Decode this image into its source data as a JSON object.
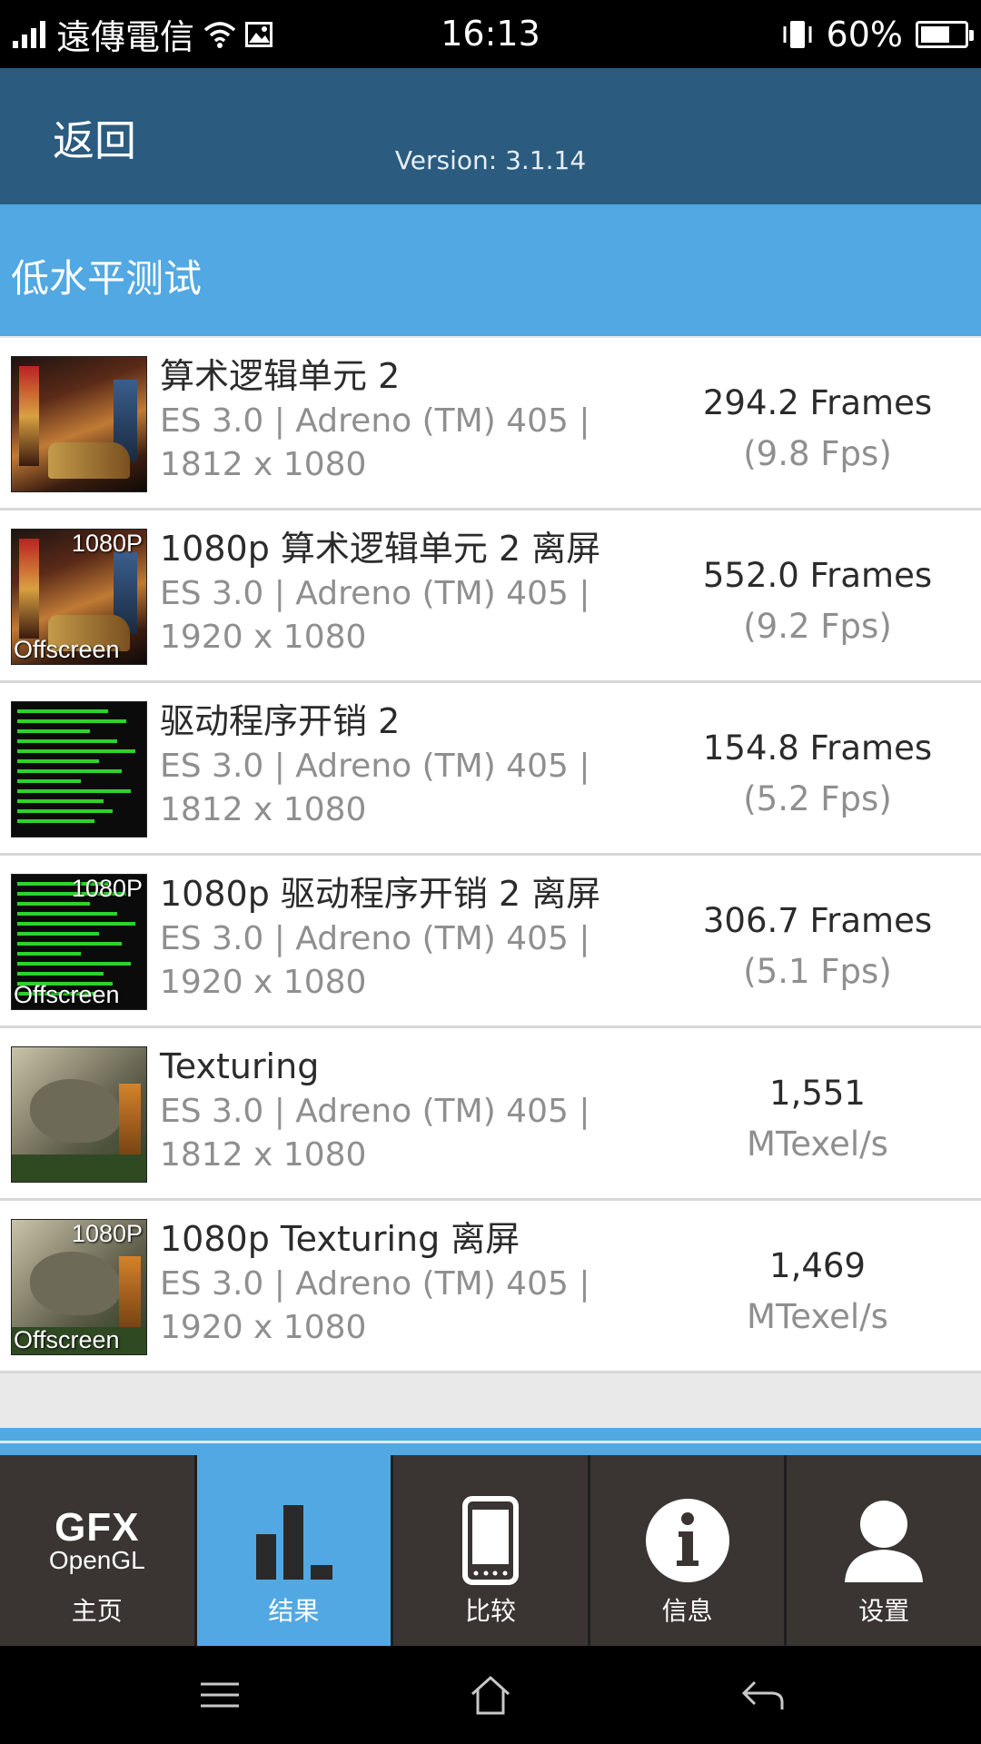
{
  "status_bar": {
    "carrier": "遠傳電信",
    "time": "16:13",
    "battery": "60%",
    "battery_level": 0.6
  },
  "header": {
    "back_label": "返回",
    "version": "Version: 3.1.14"
  },
  "section": {
    "title": "低水平测试"
  },
  "results": [
    {
      "name": "算术逻辑单元 2",
      "detail_line1": "ES 3.0 | Adreno (TM) 405 |",
      "detail_line2": "1812 x 1080",
      "primary": "294.2 Frames",
      "secondary": "(9.8 Fps)",
      "thumb": "scene",
      "tag_top": "",
      "tag_bottom": ""
    },
    {
      "name": "1080p 算术逻辑单元 2 离屏",
      "detail_line1": "ES 3.0 | Adreno (TM) 405 |",
      "detail_line2": "1920 x 1080",
      "primary": "552.0 Frames",
      "secondary": "(9.2 Fps)",
      "thumb": "scene",
      "tag_top": "1080P",
      "tag_bottom": "Offscreen"
    },
    {
      "name": "驱动程序开销 2",
      "detail_line1": "ES 3.0 | Adreno (TM) 405 |",
      "detail_line2": "1812 x 1080",
      "primary": "154.8 Frames",
      "secondary": "(5.2 Fps)",
      "thumb": "lines",
      "tag_top": "",
      "tag_bottom": ""
    },
    {
      "name": "1080p 驱动程序开销 2 离屏",
      "detail_line1": "ES 3.0 | Adreno (TM) 405 |",
      "detail_line2": "1920 x 1080",
      "primary": "306.7 Frames",
      "secondary": "(5.1 Fps)",
      "thumb": "lines",
      "tag_top": "1080P",
      "tag_bottom": "Offscreen"
    },
    {
      "name": "Texturing",
      "detail_line1": "ES 3.0 | Adreno (TM) 405 |",
      "detail_line2": "1812 x 1080",
      "primary": "1,551",
      "secondary": "MTexel/s",
      "thumb": "dino",
      "tag_top": "",
      "tag_bottom": ""
    },
    {
      "name": "1080p Texturing 离屏",
      "detail_line1": "ES 3.0 | Adreno (TM) 405 |",
      "detail_line2": "1920 x 1080",
      "primary": "1,469",
      "secondary": "MTexel/s",
      "thumb": "dino",
      "tag_top": "1080P",
      "tag_bottom": "Offscreen"
    }
  ],
  "tabs": [
    {
      "label": "主页",
      "icon": "gfx-opengl-logo",
      "logo_line1": "GFX",
      "logo_line2": "OpenGL",
      "active": false
    },
    {
      "label": "结果",
      "icon": "bar-chart-icon",
      "active": true
    },
    {
      "label": "比较",
      "icon": "phone-icon",
      "active": false
    },
    {
      "label": "信息",
      "icon": "info-icon",
      "active": false
    },
    {
      "label": "设置",
      "icon": "user-icon",
      "active": false
    }
  ],
  "nav": {
    "buttons": [
      "menu-icon",
      "home-icon",
      "back-icon"
    ]
  },
  "colors": {
    "header_bg": "#2b5b7f",
    "section_bg": "#52a8e2",
    "active_tab": "#52a8e2",
    "tab_bg": "#3a3532"
  }
}
